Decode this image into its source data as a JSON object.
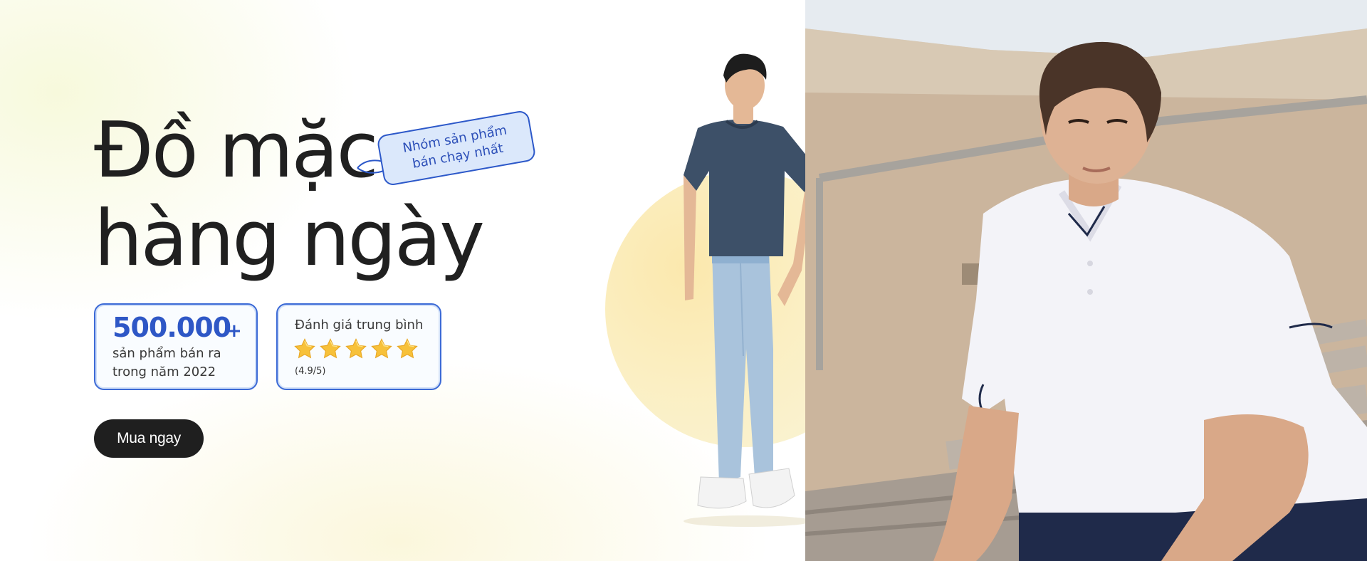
{
  "hero": {
    "headline_line1": "Đồ mặc",
    "headline_line2": "hàng ngày",
    "tag_line1": "Nhóm sản phẩm",
    "tag_line2": "bán chạy nhất"
  },
  "stats": {
    "sales_number": "500.000",
    "sales_plus": "+",
    "sales_caption_line1": "sản phẩm bán ra",
    "sales_caption_line2": "trong năm 2022",
    "rating_title": "Đánh giá trung bình",
    "rating_stars": 5,
    "rating_score": "(4.9/5)"
  },
  "cta": {
    "label": "Mua ngay"
  },
  "colors": {
    "accent_blue": "#2e57c6",
    "tag_bg": "#dbe8fb",
    "cta_bg": "#1f1f1f",
    "star": "#f7c13a",
    "circle": "#fbe8ad"
  },
  "images": {
    "standing_model": "man in navy t-shirt and light blue jeans",
    "seated_model": "man in white polo shirt sitting on stairs"
  }
}
